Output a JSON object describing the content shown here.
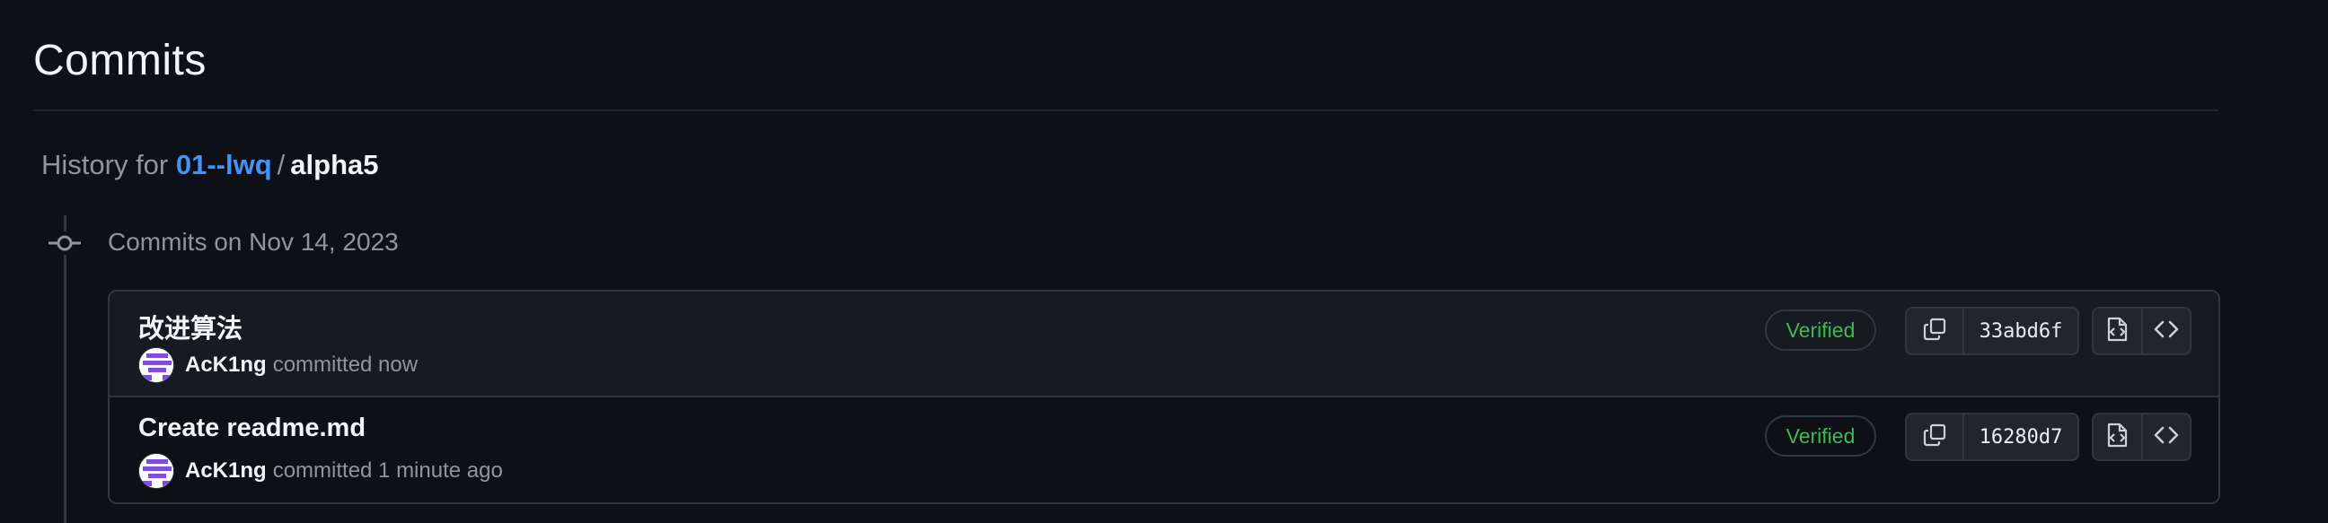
{
  "page": {
    "title": "Commits"
  },
  "history": {
    "prefix": "History for",
    "owner": "01--lwq",
    "separator": "/",
    "repo": "alpha5"
  },
  "group": {
    "heading": "Commits on Nov 14, 2023"
  },
  "commits": [
    {
      "message": "改进算法",
      "author": "AcK1ng",
      "committed_text": "committed now",
      "verified_label": "Verified",
      "sha": "33abd6f"
    },
    {
      "message": "Create readme.md",
      "author": "AcK1ng",
      "committed_text": "committed 1 minute ago",
      "verified_label": "Verified",
      "sha": "16280d7"
    }
  ],
  "icons": {
    "commit_dot": "git-commit-icon",
    "copy": "copy-icon",
    "browse_files": "file-code-icon",
    "code": "code-icon"
  },
  "colors": {
    "background": "#0d1117",
    "link": "#4493f8",
    "verified": "#3fb950",
    "muted": "#8d96a0",
    "border": "#30363d"
  }
}
